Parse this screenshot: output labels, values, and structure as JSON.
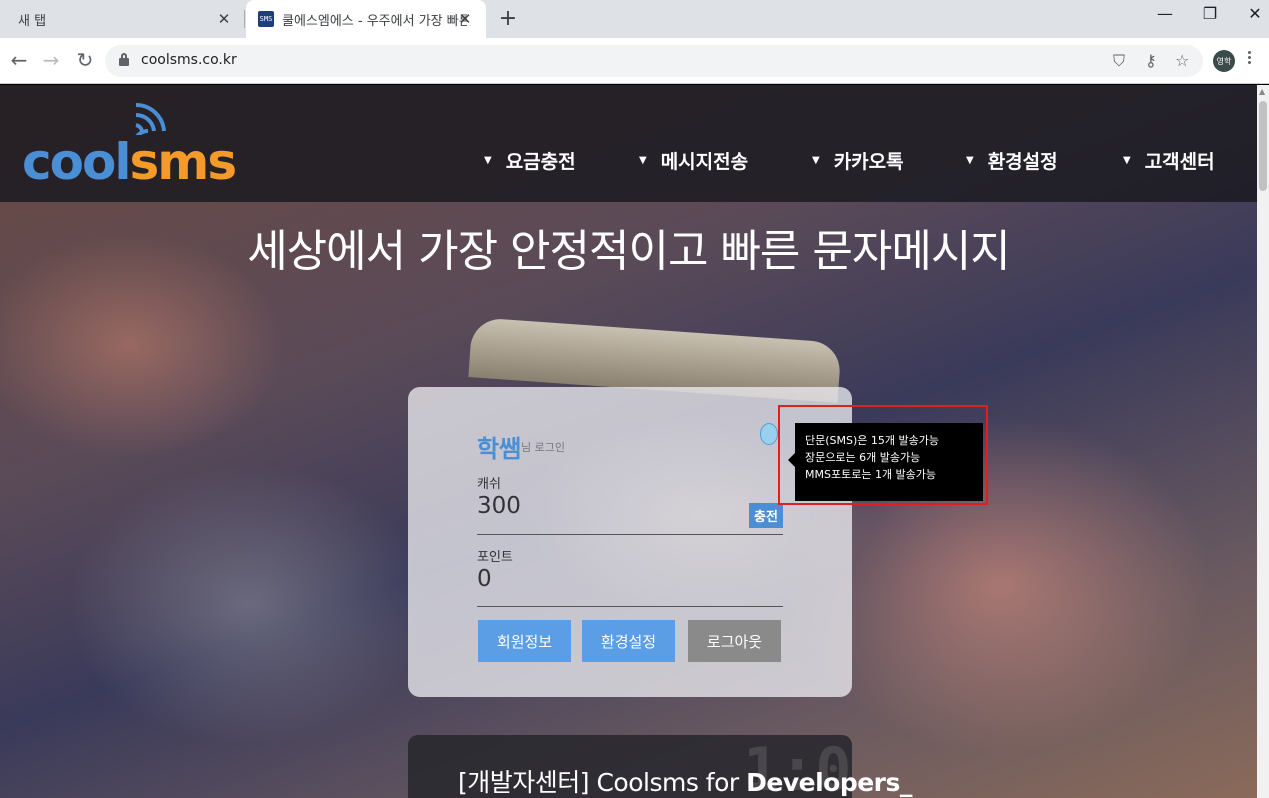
{
  "browser": {
    "tabs": [
      {
        "title": "새 탭",
        "active": false
      },
      {
        "title": "쿨에스엠에스 - 우주에서 가장 빠른",
        "active": true,
        "favicon": "SMS"
      }
    ],
    "url": "coolsms.co.kr",
    "profile_label": "영학"
  },
  "header": {
    "logo": {
      "part1": "cool",
      "part2": "sms"
    },
    "nav": [
      {
        "label": "요금충전"
      },
      {
        "label": "메시지전송"
      },
      {
        "label": "카카오톡"
      },
      {
        "label": "환경설정"
      },
      {
        "label": "고객센터"
      }
    ]
  },
  "hero": {
    "title": "세상에서 가장 안정적이고 빠른 문자메시지"
  },
  "account": {
    "name": "학쌤",
    "suffix": "님 로그인",
    "cash_label": "캐쉬",
    "cash_value": "300",
    "charge_label": "충전",
    "point_label": "포인트",
    "point_value": "0",
    "buttons": {
      "member": "회원정보",
      "settings": "환경설정",
      "logout": "로그아웃"
    }
  },
  "tooltip": {
    "lines": [
      "단문(SMS)은 15개 발송가능",
      "장문으로는 6개 발송가능",
      "MMS포토로는 1개 발송가능"
    ]
  },
  "dev": {
    "prefix": "[개발자센터] Coolsms for ",
    "bold": "Developers_"
  },
  "colors": {
    "brand_blue": "#4a8fd6",
    "brand_orange": "#f39a2a",
    "highlight": "#e02020"
  }
}
